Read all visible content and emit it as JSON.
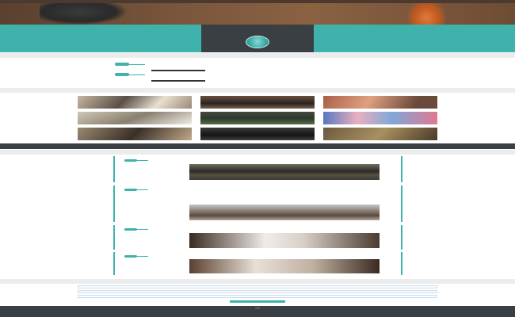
{
  "colors": {
    "accent": "#3fb2ac",
    "dark": "#3a3f43",
    "light": "#ececec"
  },
  "nav": {
    "items": [
      "",
      "",
      "",
      "",
      ""
    ]
  },
  "hero": {
    "title": "",
    "subtitle": ""
  },
  "profile": {
    "name": "",
    "subtitle": "",
    "left_text": "",
    "right_text": ""
  },
  "sections": {
    "timeline": "",
    "gallery": "",
    "posts": "",
    "contact": ""
  },
  "timeline": [
    {
      "title": "",
      "text": ""
    },
    {
      "title": "",
      "text": ""
    }
  ],
  "banner": "",
  "posts": [
    {
      "title": "",
      "meta": ""
    },
    {
      "title": "",
      "meta": ""
    },
    {
      "title": "",
      "meta": ""
    },
    {
      "title": "",
      "meta": ""
    }
  ],
  "contact": {
    "name_placeholder": "",
    "email_placeholder": "",
    "message_placeholder": "",
    "send_label": ""
  },
  "footer": {
    "text": ""
  }
}
